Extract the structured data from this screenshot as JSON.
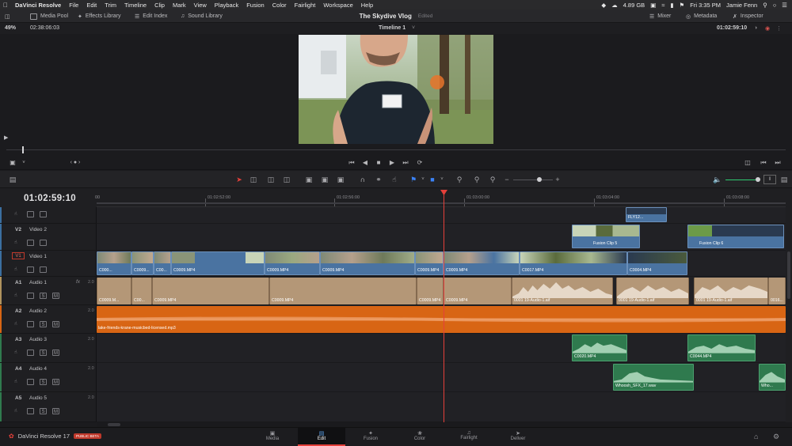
{
  "menubar": {
    "items": [
      "DaVinci Resolve",
      "File",
      "Edit",
      "Trim",
      "Timeline",
      "Clip",
      "Mark",
      "View",
      "Playback",
      "Fusion",
      "Color",
      "Fairlight",
      "Workspace",
      "Help"
    ],
    "memory": "4.89 GB",
    "datetime": "Fri 3:35 PM",
    "user": "Jamie Fenn"
  },
  "toolbar": {
    "media_pool": "Media Pool",
    "effects_library": "Effects Library",
    "edit_index": "Edit Index",
    "sound_library": "Sound Library",
    "project_title": "The Skydive Vlog",
    "project_status": "Edited",
    "mixer": "Mixer",
    "metadata": "Metadata",
    "inspector": "Inspector"
  },
  "viewer": {
    "zoom": "49%",
    "source_timecode": "02:38:06:03",
    "timeline_name": "Timeline 1",
    "record_timecode": "01:02:59:10"
  },
  "timeline": {
    "current_timecode": "01:02:59:10",
    "ruler": [
      "01:02:52:00",
      "01:02:56:00",
      "01:03:00:00",
      "01:03:04:00",
      "01:03:08:00"
    ],
    "tracks": [
      {
        "id": "V2",
        "name": "Video 2"
      },
      {
        "id": "V1",
        "name": "Video 1"
      },
      {
        "id": "A1",
        "name": "Audio 1",
        "level": "2.0"
      },
      {
        "id": "A2",
        "name": "Audio 2",
        "level": "2.0"
      },
      {
        "id": "A3",
        "name": "Audio 3",
        "level": "2.0"
      },
      {
        "id": "A4",
        "name": "Audio 4",
        "level": "2.0"
      },
      {
        "id": "A5",
        "name": "Audio 5",
        "level": "2.0"
      }
    ],
    "clips": {
      "v3_fly": "FLY12...",
      "fusion5": "Fusion Clip 5",
      "fusion6": "Fusion Clip 6",
      "v1": [
        "C000...",
        "C0009...",
        "C00...",
        "C0009.MP4",
        "C0009.MP4",
        "C0009.MP4",
        "C0009.MP4",
        "C0009.MP4",
        "C0017.MP4",
        "C0004.MP4"
      ],
      "a1": [
        "C0009.M...",
        "C00...",
        "C0009.MP4",
        "C0009.MP4",
        "C0009.MP4",
        "C0009.MP4",
        "0001 19-Audio-1.aif",
        "0001 19-Audio-1.aif",
        "0001 19-Audio-1.aif",
        "0016..."
      ],
      "a2": "lake-friends-krane-musicbed-licensed.mp3",
      "a3": [
        "C0020.MP4",
        "C0044.MP4"
      ],
      "a4": [
        "Whoosh_SFX_17.wav",
        "Who..."
      ]
    }
  },
  "track_controls": {
    "solo": "S",
    "mute": "M",
    "fx": "fx"
  },
  "pagebar": {
    "app_name": "DaVinci Resolve 17",
    "beta": "PUBLIC BETA",
    "pages": [
      "Media",
      "Edit",
      "Fusion",
      "Color",
      "Fairlight",
      "Deliver"
    ]
  },
  "colors": {
    "accent": "#e5403a",
    "video_clip": "#4a73a1",
    "audio_clip": "#b49777",
    "music_clip": "#d86514",
    "sfx_clip": "#2f7a4e"
  }
}
